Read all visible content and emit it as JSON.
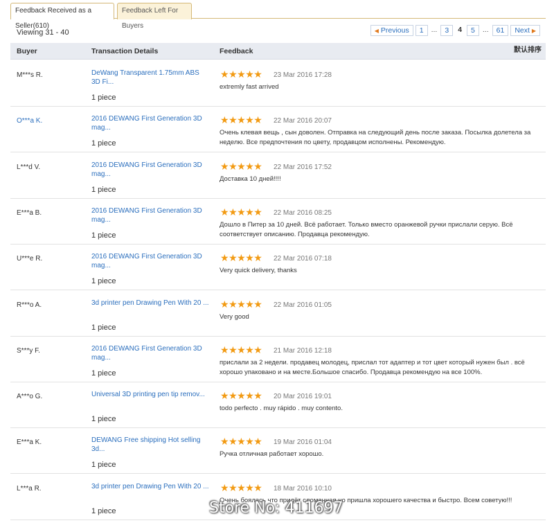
{
  "tabs": [
    {
      "label": "Feedback Received as a Seller(610)"
    },
    {
      "label": "Feedback Left For Buyers"
    }
  ],
  "viewing": "Viewing 31 - 40",
  "pager": {
    "prev": "Previous",
    "pages": [
      "1",
      "...",
      "3",
      "4",
      "5",
      "...",
      "61"
    ],
    "current": "4",
    "next": "Next"
  },
  "table": {
    "headers": {
      "buyer": "Buyer",
      "transaction": "Transaction Details",
      "feedback": "Feedback",
      "sort": "默认排序"
    },
    "rows": [
      {
        "buyer": "M***s R.",
        "product": "DeWang Transparent 1.75mm ABS 3D Fi...",
        "quantity": "1 piece",
        "rating": 5,
        "date": "23 Mar 2016 17:28",
        "comment": "extremly fast arrived"
      },
      {
        "buyer": "O***a K.",
        "product": "2016 DEWANG First Generation 3D mag...",
        "quantity": "1 piece",
        "rating": 5,
        "date": "22 Mar 2016 20:07",
        "comment": "Очень клевая вещь , сын доволен. Отправка на следующий день после заказа. Посылка долетела за неделю. Все предпочтения по цвету, продавцом исполнены. Рекомендую."
      },
      {
        "buyer": "L***d V.",
        "product": "2016 DEWANG First Generation 3D mag...",
        "quantity": "1 piece",
        "rating": 5,
        "date": "22 Mar 2016 17:52",
        "comment": "Доставка 10 дней!!!!"
      },
      {
        "buyer": "E***a B.",
        "product": "2016 DEWANG First Generation 3D mag...",
        "quantity": "1 piece",
        "rating": 5,
        "date": "22 Mar 2016 08:25",
        "comment": "Дошло в Питер за 10 дней. Всё работает. Только вместо оранжевой ручки прислали серую. Всё соответствует описанию. Продавца рекомендую."
      },
      {
        "buyer": "U***e R.",
        "product": "2016 DEWANG First Generation 3D mag...",
        "quantity": "1 piece",
        "rating": 5,
        "date": "22 Mar 2016 07:18",
        "comment": "Very quick delivery, thanks"
      },
      {
        "buyer": "R***o A.",
        "product": "3d printer pen Drawing Pen With 20 ...",
        "quantity": "1 piece",
        "rating": 5,
        "date": "22 Mar 2016 01:05",
        "comment": "Very good"
      },
      {
        "buyer": "S***y F.",
        "product": "2016 DEWANG First Generation 3D mag...",
        "quantity": "1 piece",
        "rating": 5,
        "date": "21 Mar 2016 12:18",
        "comment": "прислали за 2 недели. продавец молодец, прислал тот адаптер и тот цвет который нужен был . всё хорошо упаковано и на месте.Большое спасибо. Продавца рекомендую на все 100%."
      },
      {
        "buyer": "A***o G.",
        "product": "Universal 3D printing pen tip remov...",
        "quantity": "1 piece",
        "rating": 5,
        "date": "20 Mar 2016 19:01",
        "comment": "todo perfecto . muy rápido . muy contento."
      },
      {
        "buyer": "E***a K.",
        "product": "DEWANG Free shipping Hot selling 3d...",
        "quantity": "1 piece",
        "rating": 5,
        "date": "19 Mar 2016 01:04",
        "comment": "Ручка отличная работает хорошо."
      },
      {
        "buyer": "L***a R.",
        "product": "3d printer pen Drawing Pen With 20 ...",
        "quantity": "1 piece",
        "rating": 5,
        "date": "18 Mar 2016 10:10",
        "comment": "Очень боялась что придёт сломанная но пришла хорошего качества и быстро. Всем советую!!!"
      }
    ]
  },
  "watermark": "Store No: 411697",
  "colors": {
    "link": "#2a6ebd",
    "star": "#f29a12",
    "header_bg": "#e8ebf1",
    "tab_border": "#d4b878"
  }
}
